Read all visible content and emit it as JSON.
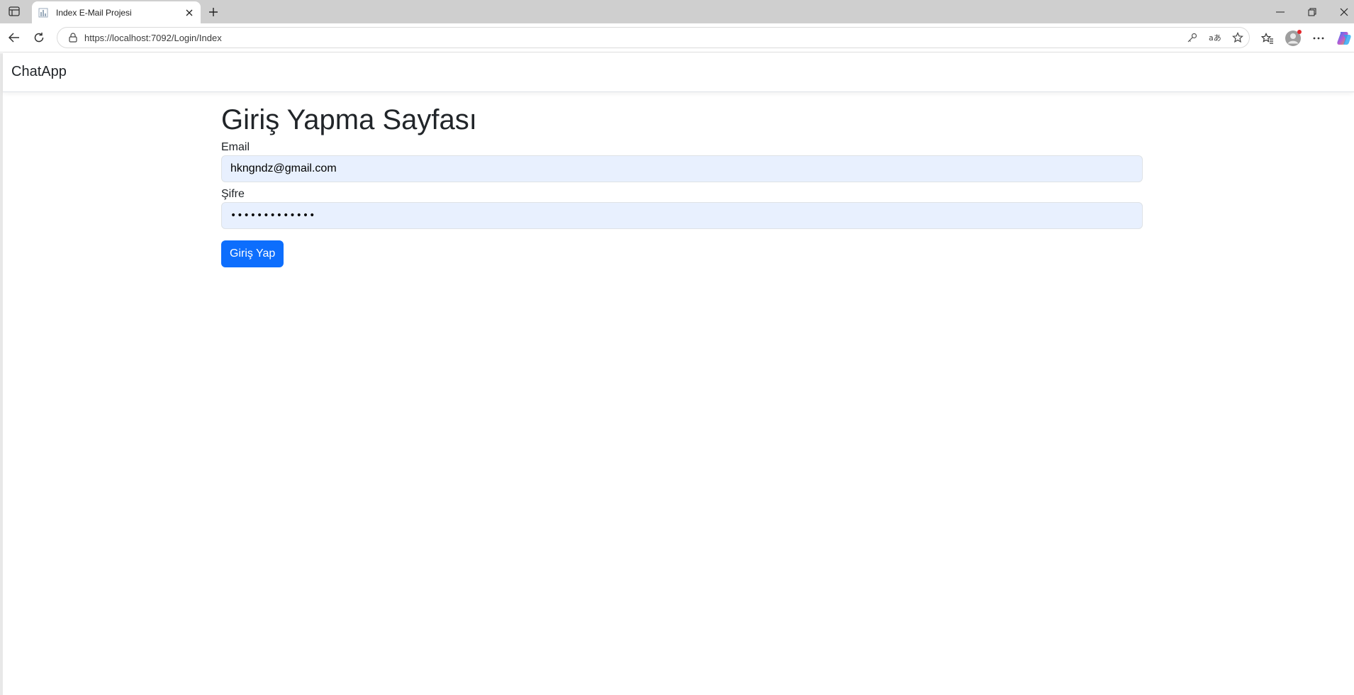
{
  "browser": {
    "tab_title": "Index E-Mail Projesi",
    "url": "https://localhost:7092/Login/Index",
    "icons": [
      "sidebar-toggle-icon",
      "tab-favicon-icon",
      "close-icon",
      "plus-icon",
      "minimize-icon",
      "restore-icon",
      "window-close-icon",
      "back-icon",
      "refresh-icon",
      "lock-icon",
      "key-icon",
      "read-aloud-icon",
      "favorite-star-icon",
      "favorites-icon",
      "profile-icon",
      "more-icon",
      "copilot-icon"
    ]
  },
  "navbar": {
    "brand": "ChatApp"
  },
  "login": {
    "title": "Giriş Yapma Sayfası",
    "email_label": "Email",
    "email_value": "hkngndz@gmail.com",
    "password_label": "Şifre",
    "password_value": "•••••••••••••",
    "submit_label": "Giriş Yap"
  },
  "colors": {
    "primary": "#0d6efd",
    "autofill_bg": "#e8f0fe",
    "text": "#212529",
    "chrome_bg": "#cfcfcf"
  }
}
